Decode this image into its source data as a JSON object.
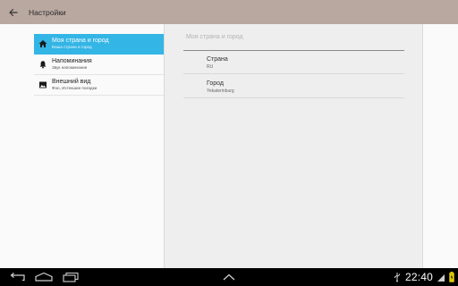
{
  "appbar": {
    "title": "Настройки",
    "back_icon": "arrow-back-icon"
  },
  "menu": {
    "items": [
      {
        "title": "Моя страна и город",
        "subtitle": "Ваша страна и город",
        "icon": "home-icon",
        "active": true
      },
      {
        "title": "Напоминания",
        "subtitle": "Звук напоминания",
        "icon": "bell-icon",
        "active": false
      },
      {
        "title": "Внешний вид",
        "subtitle": "Фон, Истекшие поездки",
        "icon": "image-icon",
        "active": false
      }
    ]
  },
  "detail": {
    "header": "Моя страна и город",
    "prefs": [
      {
        "title": "Страна",
        "value": "RU"
      },
      {
        "title": "Город",
        "value": "Yekaterinburg"
      }
    ]
  },
  "system": {
    "time": "22:40"
  },
  "colors": {
    "appbar": "#b9a8a0",
    "accent": "#33b5e5",
    "navbar": "#000000",
    "battery": "#e8d000"
  }
}
